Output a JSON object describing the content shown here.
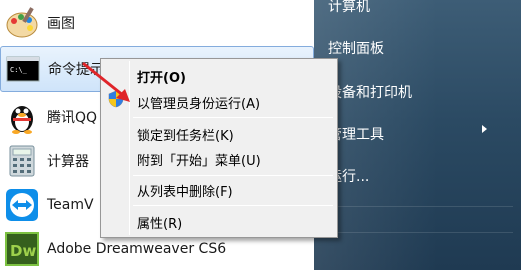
{
  "programs": [
    {
      "label": "画图",
      "icon": "paint-icon"
    },
    {
      "label": "命令提示",
      "icon": "command-prompt-icon",
      "selected": true
    },
    {
      "label": "腾讯QQ",
      "icon": "qq-penguin-icon"
    },
    {
      "label": "计算器",
      "icon": "calculator-icon"
    },
    {
      "label": "TeamV",
      "icon": "teamviewer-icon"
    },
    {
      "label": "Adobe Dreamweaver CS6",
      "icon": "dreamweaver-icon"
    }
  ],
  "dreamweaver_badge": "Dw",
  "right_pane": {
    "computer": "计算机",
    "control_panel": "控制面板",
    "devices_printers": "设备和打印机",
    "admin_tools": "管理工具",
    "run": "运行..."
  },
  "context_menu": {
    "open": "打开(O)",
    "run_as_admin": "以管理员身份运行(A)",
    "pin_taskbar": "锁定到任务栏(K)",
    "pin_start": "附到「开始」菜单(U)",
    "remove_list": "从列表中删除(F)",
    "properties": "属性(R)"
  },
  "colors": {
    "annotation_arrow": "#e0252a",
    "selection_border": "#84acdd",
    "right_pane_bg": "#2b4a63"
  }
}
